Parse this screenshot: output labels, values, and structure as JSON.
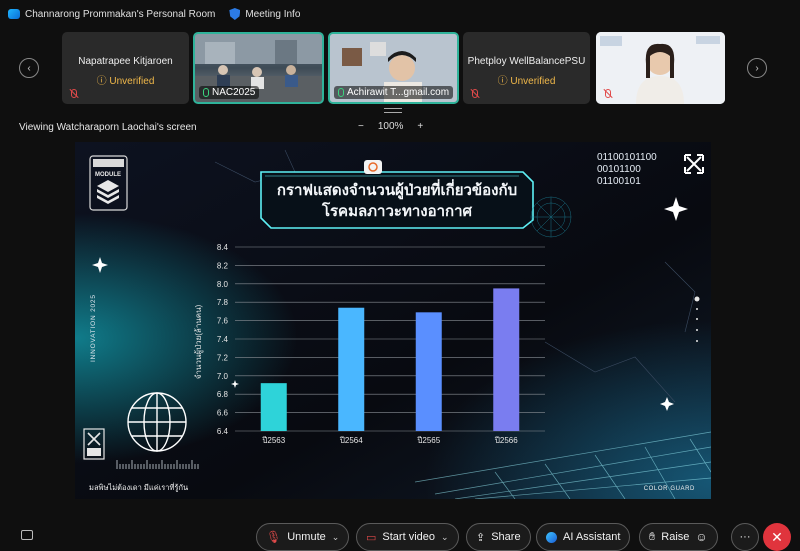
{
  "topbar": {
    "room_name": "Channarong Prommakan's Personal Room",
    "meeting_info": "Meeting Info"
  },
  "participants": [
    {
      "name": "Napatrapee Kitjaroen",
      "status": "Unverified"
    },
    {
      "name": "NAC2025"
    },
    {
      "name": "Achirawit T...gmail.com"
    },
    {
      "name": "Phetploy WellBalancePSU",
      "status": "Unverified"
    }
  ],
  "share": {
    "title": "Viewing Watcharaporn Laochai's screen",
    "zoom_out": "−",
    "zoom_level": "100%",
    "zoom_in": "+"
  },
  "slide": {
    "module_word": "MODULE",
    "binary_lines": [
      "01100101100",
      "00101100",
      "01100101"
    ],
    "title_line1": "กราฟแสดงจำนวนผู้ป่วยที่เกี่ยวข้องกับ",
    "title_line2": "โรคมลภาวะทางอากาศ",
    "side_text": "INNOVATION 2025",
    "footer_left": "มลพิษไม่ต้องเดา มีแค่เราที่รู้กัน",
    "footer_right": "COLOR GUARD"
  },
  "chart_data": {
    "type": "bar",
    "categories": [
      "ปี2563",
      "ปี2564",
      "ปี2565",
      "ปี2566"
    ],
    "values": [
      6.92,
      7.74,
      7.69,
      7.95
    ],
    "ylabel": "จำนวนผู้ป่วย(ล้านคน)",
    "ylim": [
      6.4,
      8.4
    ],
    "yticks": [
      "6.4",
      "6.6",
      "6.8",
      "7.0",
      "7.2",
      "7.4",
      "7.6",
      "7.8",
      "8.0",
      "8.2",
      "8.4"
    ],
    "colors": [
      "#2ed3d9",
      "#4ab7ff",
      "#5a8fff",
      "#7a7df0"
    ],
    "grid": true
  },
  "toolbar": {
    "unmute": "Unmute",
    "start_video": "Start video",
    "share": "Share",
    "ai_assistant": "AI Assistant",
    "raise": "Raise",
    "more": "···",
    "leave": "✕"
  }
}
